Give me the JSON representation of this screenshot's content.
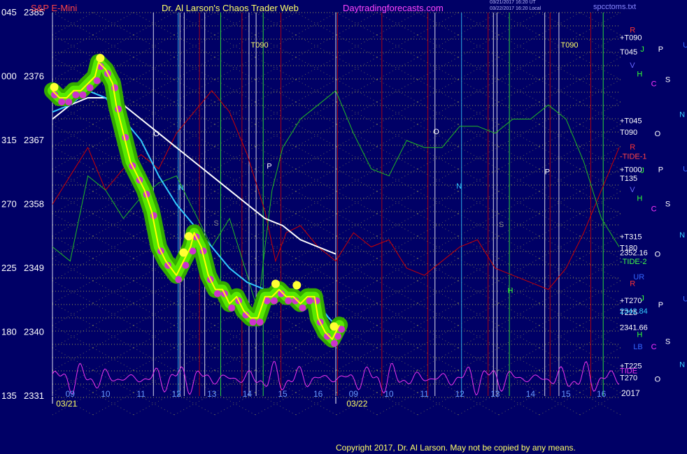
{
  "header": {
    "symbol": "S&P E-Mini",
    "title": "Dr. Al Larson's Chaos Trader Web",
    "site": "Daytradingforecasts.com",
    "timestamp_1": "03/21/2017 16:20 UT",
    "timestamp_2": "03/22/2017 16:20 Local",
    "chart_file": "spcctoms.txt"
  },
  "footer": {
    "copyright": "Copyright 2017, Dr. Al Larson. May not be copied by any means."
  },
  "colors": {
    "background": "#000066",
    "price_glow_outer": "#33aa00",
    "price_glow_inner": "#66ff00",
    "price_dots": "#cc33cc",
    "price_line": "#ffff00",
    "price_highlight": "#ffff33",
    "ma_white": "#ffffff",
    "ma_cyan": "#33ccff",
    "flux_red": "#cc0000",
    "flux_green": "#22bb22",
    "tide_magenta": "#ee33ee",
    "grid_dots": "#cccc44"
  },
  "chart_data": {
    "type": "line",
    "title": "S&P E-Mini",
    "left_axis_labels": [
      "045",
      "000",
      "315",
      "270",
      "225",
      "180",
      "135"
    ],
    "price_axis": [
      "2385",
      "2376",
      "2367",
      "2358",
      "2349",
      "2340",
      "2331"
    ],
    "ylim": [
      2331,
      2385
    ],
    "x_hours": [
      "09",
      "10",
      "11",
      "12",
      "13",
      "14",
      "15",
      "16",
      "09",
      "10",
      "11",
      "12",
      "13",
      "14",
      "15",
      "16"
    ],
    "xlim": [
      0,
      16
    ],
    "date_labels": [
      {
        "text": "03/21",
        "x": 0.4
      },
      {
        "text": "03/22",
        "x": 8.6
      }
    ],
    "year_label": "2017",
    "price_series": {
      "name": "ES price",
      "x": [
        0,
        0.2,
        0.4,
        0.6,
        0.8,
        1.0,
        1.2,
        1.3,
        1.5,
        1.7,
        1.8,
        2.0,
        2.2,
        2.4,
        2.6,
        2.8,
        3.0,
        3.2,
        3.5,
        3.7,
        3.9,
        4.0,
        4.2,
        4.4,
        4.6,
        4.8,
        5.0,
        5.2,
        5.4,
        5.6,
        5.8,
        6.0,
        6.2,
        6.4,
        6.6,
        6.8,
        7.0,
        7.2,
        7.4,
        7.5,
        7.7,
        7.9,
        8.0,
        8.1
      ],
      "y": [
        2374,
        2373,
        2373,
        2374,
        2374,
        2375,
        2376,
        2378,
        2377,
        2375,
        2372,
        2368,
        2364,
        2362,
        2360,
        2357,
        2352,
        2350,
        2348,
        2350,
        2352,
        2354,
        2352,
        2348,
        2346,
        2346,
        2344,
        2345,
        2343,
        2342,
        2342,
        2345,
        2345,
        2346,
        2345,
        2345,
        2344,
        2345,
        2345,
        2342,
        2340,
        2339,
        2340,
        2341
      ]
    },
    "yellow_highlights": [
      {
        "x": 0.05,
        "y": 2374.5
      },
      {
        "x": 1.35,
        "y": 2378.6
      },
      {
        "x": 3.7,
        "y": 2351.2
      },
      {
        "x": 3.85,
        "y": 2353.5
      },
      {
        "x": 6.3,
        "y": 2346.8
      },
      {
        "x": 6.9,
        "y": 2346.6
      },
      {
        "x": 7.95,
        "y": 2340.8
      }
    ],
    "ma_white": {
      "name": "moving average (white)",
      "x": [
        0,
        0.5,
        1.0,
        1.5,
        2.0,
        2.5,
        3.0,
        3.5,
        4.0,
        4.5,
        5.0,
        5.5,
        6.0,
        6.5,
        7.0,
        7.5,
        8.0
      ],
      "y": [
        2370,
        2372,
        2373,
        2373,
        2372,
        2370,
        2368,
        2366,
        2364,
        2362,
        2360,
        2358,
        2356,
        2355,
        2353,
        2352,
        2351
      ]
    },
    "ma_cyan": {
      "name": "moving average (cyan)",
      "x": [
        0,
        0.5,
        1.0,
        1.5,
        2.0,
        2.5,
        3.0,
        3.5,
        4.0,
        4.5,
        5.0,
        5.5,
        6.0,
        6.5,
        7.0,
        7.5,
        7.8,
        8.0
      ],
      "y": [
        2371,
        2372,
        2374,
        2373,
        2370,
        2367,
        2362,
        2358,
        2355,
        2352,
        2349,
        2347,
        2346,
        2345,
        2345,
        2344,
        2342,
        2341
      ]
    },
    "flux_green": {
      "name": "green flux",
      "x": [
        0,
        0.5,
        1.0,
        1.5,
        2.0,
        2.5,
        3.0,
        3.5,
        4.0,
        4.5,
        5.0,
        5.5,
        5.8,
        6.0,
        6.2,
        6.5,
        7.0,
        7.5,
        8.0,
        8.5,
        9.0,
        9.5,
        10.0,
        10.5,
        11.0,
        11.5,
        12.0,
        12.5,
        13.0,
        13.5,
        14.0,
        14.5,
        15.0,
        15.5,
        16.0
      ],
      "y": [
        2352,
        2350,
        2362,
        2360,
        2356,
        2359,
        2361,
        2362,
        2357,
        2352,
        2356,
        2348,
        2343,
        2352,
        2360,
        2366,
        2370,
        2372,
        2374,
        2368,
        2363,
        2362,
        2367,
        2366,
        2366,
        2369,
        2369,
        2368,
        2370,
        2370,
        2372,
        2370,
        2364,
        2356,
        2352
      ]
    },
    "flux_red": {
      "name": "red flux",
      "x": [
        0,
        0.5,
        1.0,
        1.5,
        2.0,
        2.5,
        3.0,
        3.5,
        4.0,
        4.5,
        5.0,
        5.5,
        6.0,
        6.3,
        6.6,
        7.0,
        7.5,
        8.0,
        8.5,
        9.0,
        9.5,
        10.0,
        10.5,
        11.0,
        11.5,
        12.0,
        12.5,
        13.0,
        13.5,
        14.0,
        14.5,
        15.0,
        15.5,
        16.0
      ],
      "y": [
        2358,
        2362,
        2366,
        2360,
        2363,
        2365,
        2363,
        2368,
        2371,
        2374,
        2371,
        2365,
        2357,
        2350,
        2354,
        2355,
        2352,
        2350,
        2354,
        2352,
        2353,
        2349,
        2348,
        2350,
        2352,
        2353,
        2349,
        2348,
        2347,
        2346,
        2349,
        2354,
        2360,
        2366
      ]
    },
    "tide_magenta": {
      "name": "TIDE",
      "range": [
        2331,
        2336
      ]
    },
    "right_labels": [
      {
        "text": "+T090",
        "y": 2381.5,
        "color": "#ffffff"
      },
      {
        "text": "T045",
        "y": 2379.5,
        "color": "#ffffff"
      },
      {
        "text": "+T045",
        "y": 2369.8,
        "color": "#ffffff"
      },
      {
        "text": "T090",
        "y": 2368.2,
        "color": "#ffffff"
      },
      {
        "text": "-TIDE-1",
        "y": 2364.8,
        "color": "#ff4444"
      },
      {
        "text": "+T000",
        "y": 2362.9,
        "color": "#ffffff"
      },
      {
        "text": "T135",
        "y": 2361.7,
        "color": "#ffffff"
      },
      {
        "text": "+T315",
        "y": 2353.5,
        "color": "#ffffff"
      },
      {
        "text": "T180",
        "y": 2351.9,
        "color": "#ffffff"
      },
      {
        "text": "2352.16",
        "y": 2351.2,
        "color": "#ffffff"
      },
      {
        "text": "-TIDE-2",
        "y": 2350.0,
        "color": "#44ff44"
      },
      {
        "text": "+T270",
        "y": 2344.5,
        "color": "#ffffff"
      },
      {
        "text": "T225",
        "y": 2342.8,
        "color": "#ffffff"
      },
      {
        "text": "2342.84",
        "y": 2343.0,
        "color": "#33ccff"
      },
      {
        "text": "2341.66",
        "y": 2340.7,
        "color": "#ffffff"
      },
      {
        "text": "+T225",
        "y": 2335.3,
        "color": "#ffffff"
      },
      {
        "text": "TIDE",
        "y": 2334.6,
        "color": "#ee33ee"
      },
      {
        "text": "T270",
        "y": 2333.6,
        "color": "#ffffff"
      }
    ],
    "planet_labels": [
      {
        "text": "R",
        "x": 16.3,
        "y": 2382.6,
        "color": "#ff3333"
      },
      {
        "text": "J",
        "x": 16.6,
        "y": 2379.9,
        "color": "#33ff33"
      },
      {
        "text": "P",
        "x": 17.1,
        "y": 2379.9,
        "color": "#ffffff"
      },
      {
        "text": "U",
        "x": 17.8,
        "y": 2380.5,
        "color": "#3366ff"
      },
      {
        "text": "V",
        "x": 16.3,
        "y": 2377.6,
        "color": "#6666ff"
      },
      {
        "text": "H",
        "x": 16.5,
        "y": 2376.4,
        "color": "#33ff33"
      },
      {
        "text": "C",
        "x": 16.9,
        "y": 2375.0,
        "color": "#ff33ff"
      },
      {
        "text": "S",
        "x": 17.3,
        "y": 2375.6,
        "color": "#ffffff"
      },
      {
        "text": "N",
        "x": 17.7,
        "y": 2370.7,
        "color": "#33ccff"
      },
      {
        "text": "O",
        "x": 17.0,
        "y": 2368.0,
        "color": "#ffffff"
      },
      {
        "text": "R",
        "x": 16.3,
        "y": 2366.1,
        "color": "#ff3333"
      },
      {
        "text": "J",
        "x": 16.6,
        "y": 2362.8,
        "color": "#33ff33"
      },
      {
        "text": "P",
        "x": 17.1,
        "y": 2362.9,
        "color": "#ffffff"
      },
      {
        "text": "U",
        "x": 17.8,
        "y": 2363.0,
        "color": "#3366ff"
      },
      {
        "text": "V",
        "x": 16.3,
        "y": 2360.1,
        "color": "#6666ff"
      },
      {
        "text": "H",
        "x": 16.5,
        "y": 2358.9,
        "color": "#33ff33"
      },
      {
        "text": "C",
        "x": 16.9,
        "y": 2357.4,
        "color": "#ff33ff"
      },
      {
        "text": "S",
        "x": 17.3,
        "y": 2358.1,
        "color": "#ffffff"
      },
      {
        "text": "N",
        "x": 17.7,
        "y": 2353.7,
        "color": "#33ccff"
      },
      {
        "text": "O",
        "x": 17.0,
        "y": 2351.0,
        "color": "#ffffff"
      },
      {
        "text": "UR",
        "x": 16.4,
        "y": 2347.8,
        "color": "#3366ff"
      },
      {
        "text": "R",
        "x": 16.3,
        "y": 2346.9,
        "color": "#ff3333"
      },
      {
        "text": "J",
        "x": 16.6,
        "y": 2344.8,
        "color": "#33ff33"
      },
      {
        "text": "P",
        "x": 17.1,
        "y": 2343.9,
        "color": "#ffffff"
      },
      {
        "text": "U",
        "x": 17.8,
        "y": 2344.7,
        "color": "#3366ff"
      },
      {
        "text": "H",
        "x": 16.5,
        "y": 2339.7,
        "color": "#33ff33"
      },
      {
        "text": "LB",
        "x": 16.4,
        "y": 2338.0,
        "color": "#3366ff"
      },
      {
        "text": "C",
        "x": 16.9,
        "y": 2338.0,
        "color": "#ff33ff"
      },
      {
        "text": "S",
        "x": 17.3,
        "y": 2338.7,
        "color": "#ffffff"
      },
      {
        "text": "N",
        "x": 17.7,
        "y": 2335.5,
        "color": "#33ccff"
      },
      {
        "text": "O",
        "x": 17.0,
        "y": 2333.4,
        "color": "#ffffff"
      }
    ],
    "in_chart_labels": [
      {
        "text": "O",
        "x": 2.85,
        "y": 2368.0,
        "color": "#ffffff"
      },
      {
        "text": "P",
        "x": 6.05,
        "y": 2363.4,
        "color": "#ffffff"
      },
      {
        "text": "N",
        "x": 3.55,
        "y": 2360.4,
        "color": "#33ccff"
      },
      {
        "text": "S",
        "x": 4.55,
        "y": 2355.4,
        "color": "#888888"
      },
      {
        "text": "T090",
        "x": 5.6,
        "y": 2380.5,
        "color": "#ffff66"
      },
      {
        "text": "O",
        "x": 10.75,
        "y": 2368.3,
        "color": "#ffffff"
      },
      {
        "text": "P",
        "x": 13.9,
        "y": 2362.6,
        "color": "#ffffff"
      },
      {
        "text": "N",
        "x": 11.4,
        "y": 2360.6,
        "color": "#33ccff"
      },
      {
        "text": "S",
        "x": 12.6,
        "y": 2355.2,
        "color": "#888888"
      },
      {
        "text": "H",
        "x": 12.85,
        "y": 2345.9,
        "color": "#33ff33"
      },
      {
        "text": "T090",
        "x": 14.35,
        "y": 2380.5,
        "color": "#ffff66"
      }
    ],
    "vertical_lines": [
      {
        "x": 2.85,
        "color": "#ffffff"
      },
      {
        "x": 3.6,
        "color": "#ffffff"
      },
      {
        "x": 3.72,
        "color": "#ffffff"
      },
      {
        "x": 3.55,
        "color": "#33ccff"
      },
      {
        "x": 4.3,
        "color": "#ffffff"
      },
      {
        "x": 4.75,
        "color": "#33ff33"
      },
      {
        "x": 5.55,
        "color": "#ffffff"
      },
      {
        "x": 5.75,
        "color": "#ffffff"
      },
      {
        "x": 5.95,
        "color": "#33ff33"
      },
      {
        "x": 4.15,
        "color": "#cc0000"
      },
      {
        "x": 5.35,
        "color": "#cc0000"
      },
      {
        "x": 6.45,
        "color": "#cc0000"
      },
      {
        "x": 8.05,
        "color": "#cc0000"
      },
      {
        "x": 9.3,
        "color": "#cc0000"
      },
      {
        "x": 10.6,
        "color": "#cc0000"
      },
      {
        "x": 10.8,
        "color": "#ffffff"
      },
      {
        "x": 11.55,
        "color": "#33ccff"
      },
      {
        "x": 12.3,
        "color": "#cc0000"
      },
      {
        "x": 12.45,
        "color": "#ffffff"
      },
      {
        "x": 12.55,
        "color": "#ffffff"
      },
      {
        "x": 12.9,
        "color": "#33ff33"
      },
      {
        "x": 13.9,
        "color": "#ffffff"
      },
      {
        "x": 14.3,
        "color": "#ffffff"
      },
      {
        "x": 14.05,
        "color": "#cc0000"
      },
      {
        "x": 15.2,
        "color": "#cc0000"
      },
      {
        "x": 15.55,
        "color": "#33ff33"
      },
      {
        "x": 0.0,
        "color": "#ffffff"
      },
      {
        "x": 8.0,
        "color": "#ffffff"
      }
    ]
  }
}
